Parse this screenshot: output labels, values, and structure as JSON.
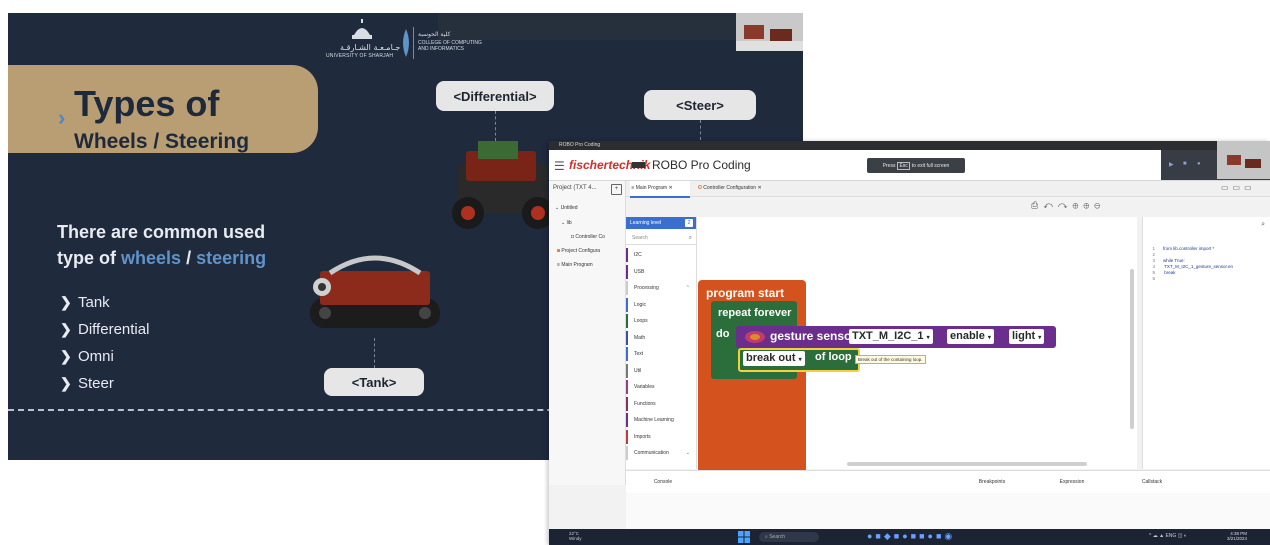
{
  "slide": {
    "university_en": "UNIVERSITY OF SHARJAH",
    "university_ar": "جـامـعـة الشـارقـة",
    "college_ar": "كلية الحوسبة",
    "college_en_1": "COLLEGE OF COMPUTING",
    "college_en_2": "AND INFORMATICS",
    "title_1": "Types of",
    "title_2": "Wheels / Steering",
    "subtitle_part1": "There are common used",
    "subtitle_part2": "type of",
    "subtitle_wheels": "wheels",
    "subtitle_sep": "/",
    "subtitle_steering": "steering",
    "bullets": [
      "Tank",
      "Differential",
      "Omni",
      "Steer"
    ],
    "tags": {
      "differential": "<Differential>",
      "steer": "<Steer>",
      "tank": "<Tank>"
    },
    "colors": {
      "background": "#1f2a3d",
      "title_box": "#b89e72",
      "accent": "#5f93c9"
    }
  },
  "app": {
    "window_title": "ROBO Pro Coding",
    "brand": "fischertechnik",
    "app_title": "ROBO Pro Coding",
    "fullscreen_note_pre": "Press",
    "fullscreen_key": "Esc",
    "fullscreen_note_post": "to exit full screen",
    "project_header": "Project (TXT 4...",
    "tree": {
      "untitled": "Untitled",
      "lib": "lib",
      "controller": "Controller Co",
      "project_config": "Project Configura",
      "main_program": "Main Program"
    },
    "tabs": {
      "main": "Main Program",
      "controller": "Controller Configuration"
    },
    "learning_level_label": "Learning level",
    "learning_level_value": "2",
    "search_placeholder": "Search",
    "categories": [
      "I2C",
      "USB",
      "Processing",
      "Logic",
      "Loops",
      "Math",
      "Text",
      "Util",
      "Variables",
      "Functions",
      "Machine Learning",
      "Imports",
      "Communication"
    ],
    "category_colors": [
      "#6b2e8c",
      "#6b2e8c",
      "#cccccc",
      "#3a6fd0",
      "#2c6e3b",
      "#3a4fb0",
      "#3a6fd0",
      "#777777",
      "#9a3a8c",
      "#8c2e5a",
      "#6b2e8c",
      "#c23a3a",
      "#cccccc"
    ],
    "blocks": {
      "program_start": "program start",
      "repeat_forever": "repeat forever",
      "do": "do",
      "gesture_sensor": "gesture sensor",
      "sensor_name": "TXT_M_I2C_1",
      "enable": "enable",
      "light": "light",
      "break_out": "break out",
      "of_loop": "of loop",
      "tooltip": "Break out of the containing loop."
    },
    "code": [
      {
        "n": "1",
        "t": "from lib.controller import *"
      },
      {
        "n": "2",
        "t": ""
      },
      {
        "n": "3",
        "t": "while True:"
      },
      {
        "n": "4",
        "t": "  TXT_M_I2C_1_gesture_sensor.en"
      },
      {
        "n": "5",
        "t": "  break"
      },
      {
        "n": "6",
        "t": ""
      }
    ],
    "bottom_tabs": {
      "console": "Console",
      "breakpoints": "Breakpoints",
      "expression": "Expression",
      "callstack": "Callstack"
    },
    "taskbar": {
      "weather_temp": "22°C",
      "weather_desc": "Windy",
      "search": "Search",
      "lang": "ENG",
      "time": "4:38 PM",
      "date": "3/21/2024"
    }
  }
}
